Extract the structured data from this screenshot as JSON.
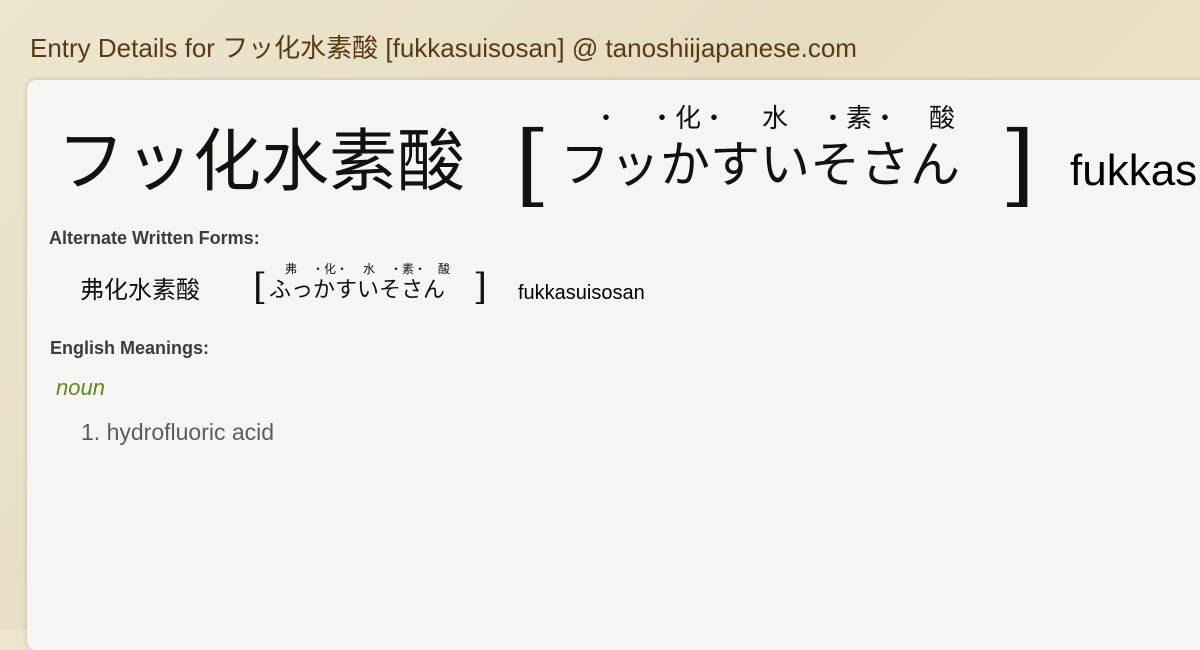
{
  "page": {
    "title": "Entry Details for フッ化水素酸 [fukkasuisosan] @ tanoshiijapanese.com"
  },
  "entry": {
    "headword": "フッ化水素酸",
    "bracket_open": "[",
    "bracket_close": "]",
    "reading": "フッかすいそさん",
    "reading_furigana": {
      "f1": "・",
      "f2": "・化・",
      "f3": "水",
      "f4": "・素・",
      "f5": "酸"
    },
    "romaji": "fukkasuisosan"
  },
  "alternate_forms": {
    "label": "Alternate Written Forms:",
    "items": [
      {
        "kanji": "弗化水素酸",
        "reading": "ふっかすいそさん",
        "furigana": {
          "f1": "弗",
          "f2": "・化・",
          "f3": "水",
          "f4": "・素・",
          "f5": "酸"
        },
        "romaji": "fukkasuisosan"
      }
    ]
  },
  "meanings": {
    "label": "English Meanings:",
    "part_of_speech": "noun",
    "items": [
      {
        "number": "1.",
        "text": "hydrofluoric acid"
      }
    ]
  }
}
